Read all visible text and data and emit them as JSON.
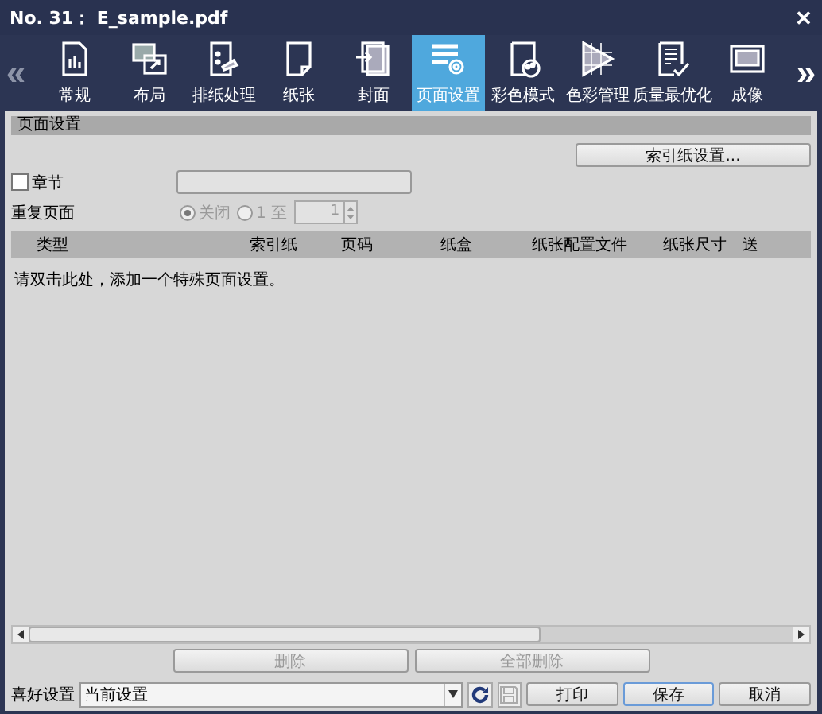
{
  "window": {
    "title": "No. 31： E_sample.pdf",
    "close": "✕"
  },
  "toolbar": {
    "prev": "«",
    "next": "»",
    "tabs": [
      {
        "label": "常规",
        "selected": false
      },
      {
        "label": "布局",
        "selected": false
      },
      {
        "label": "排纸处理",
        "selected": false
      },
      {
        "label": "纸张",
        "selected": false
      },
      {
        "label": "封面",
        "selected": false
      },
      {
        "label": "页面设置",
        "selected": true
      },
      {
        "label": "彩色模式",
        "selected": false
      },
      {
        "label": "色彩管理",
        "selected": false
      },
      {
        "label": "质量最优化",
        "selected": false
      },
      {
        "label": "成像",
        "selected": false
      }
    ]
  },
  "section": {
    "title": "页面设置",
    "index_button": {
      "label": "索引纸设置..."
    },
    "chapter": {
      "label": "章节",
      "checked": false
    },
    "repeat": {
      "label": "重复页面",
      "disabled": true,
      "options": [
        {
          "label": "关闭",
          "selected": true
        },
        {
          "label": "1 至",
          "selected": false
        }
      ],
      "spinner": "1"
    }
  },
  "table": {
    "columns": [
      "类型",
      "索引纸",
      "页码",
      "纸盒",
      "纸张配置文件",
      "纸张尺寸",
      "送"
    ],
    "hint": "请双击此处，添加一个特殊页面设置。"
  },
  "actions": [
    {
      "label": "删除",
      "disabled": true
    },
    {
      "label": "全部删除",
      "disabled": true
    }
  ],
  "footer": {
    "label": "喜好设置",
    "preset": "当前设置",
    "save_icon_disabled": true,
    "buttons": [
      {
        "label": "打印",
        "focused": false
      },
      {
        "label": "保存",
        "focused": true
      },
      {
        "label": "取消",
        "focused": false
      }
    ]
  }
}
